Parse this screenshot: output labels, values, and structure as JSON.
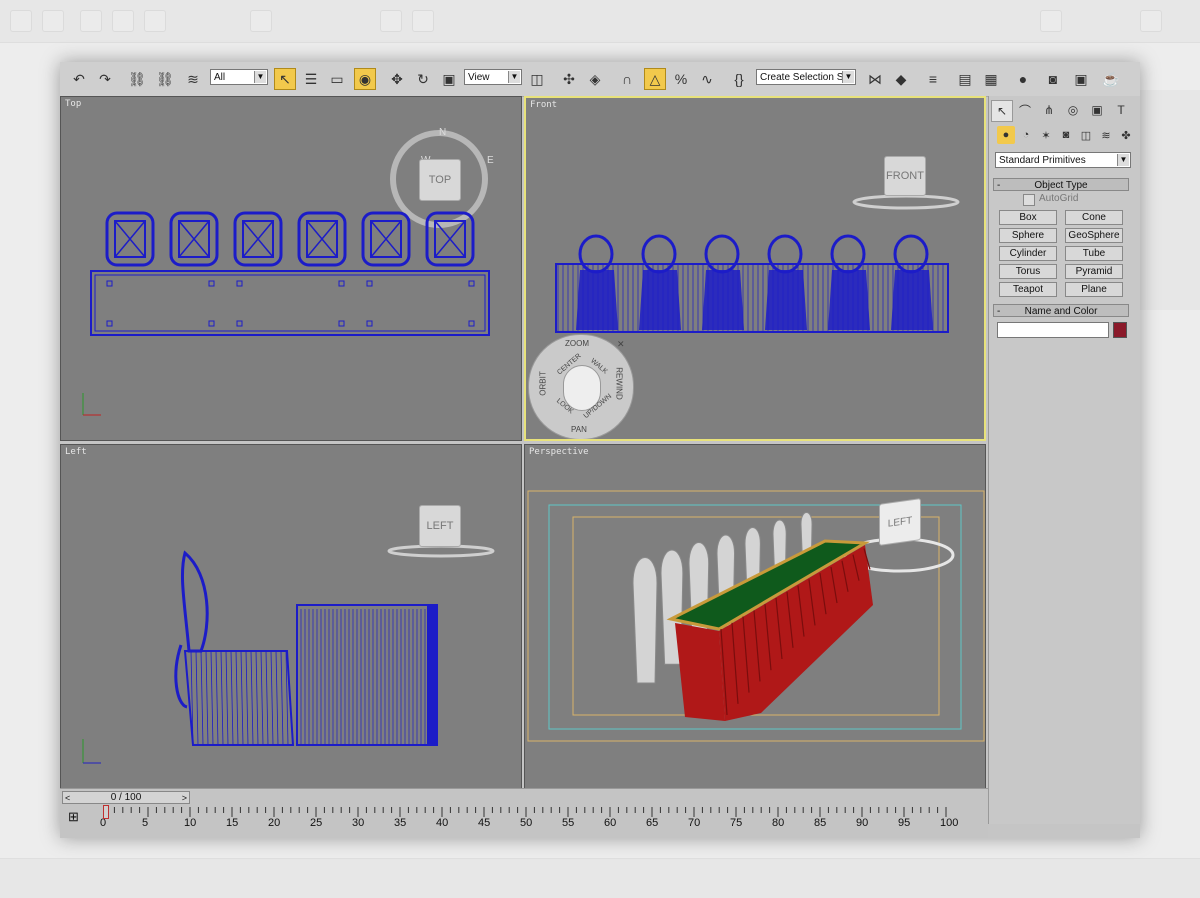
{
  "toolbar": {
    "selection_filter": "All",
    "reference_coord": "View",
    "named_selection": "Create Selection Set"
  },
  "viewports": {
    "top": {
      "label": "Top",
      "viewcube": "TOP",
      "compass": [
        "N",
        "W",
        "E"
      ]
    },
    "front": {
      "label": "Front",
      "viewcube": "FRONT"
    },
    "left": {
      "label": "Left",
      "viewcube": "LEFT"
    },
    "perspective": {
      "label": "Perspective",
      "viewcube": "LEFT"
    }
  },
  "steering_wheel": {
    "zoom": "ZOOM",
    "orbit": "ORBIT",
    "rewind": "REWIND",
    "pan": "PAN",
    "center": "CENTER",
    "walk": "WALK",
    "look": "LOOK",
    "updown": "UP/DOWN"
  },
  "command_panel": {
    "category": "Standard Primitives",
    "object_type_header": "Object Type",
    "autogrid_label": "AutoGrid",
    "buttons": [
      "Box",
      "Cone",
      "Sphere",
      "GeoSphere",
      "Cylinder",
      "Tube",
      "Torus",
      "Pyramid",
      "Teapot",
      "Plane"
    ],
    "name_color_header": "Name and Color",
    "name_value": "",
    "object_color": "#8b1a2a"
  },
  "timeline": {
    "frame_counter": "0 / 100",
    "ticks": [
      "0",
      "5",
      "10",
      "15",
      "20",
      "25",
      "30",
      "35",
      "40",
      "45",
      "50",
      "55",
      "60",
      "65",
      "70",
      "75",
      "80",
      "85",
      "90",
      "95",
      "100"
    ]
  },
  "colors": {
    "viewport_bg": "#7f7f7f",
    "wire_blue": "#1c1cc8",
    "table_green": "#0f5a1c",
    "skirt_red": "#b01818",
    "active_border": "#e8e27a"
  }
}
